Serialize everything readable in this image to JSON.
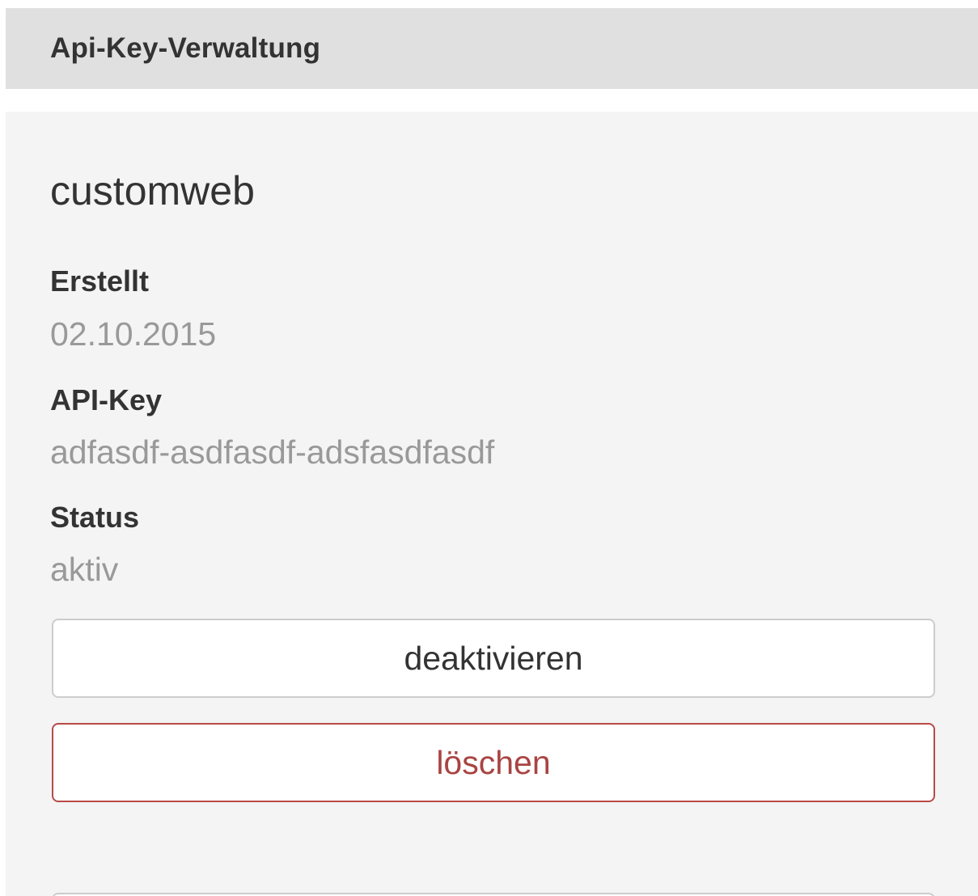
{
  "header": {
    "title": "Api-Key-Verwaltung"
  },
  "api_key_card": {
    "name": "customweb",
    "fields": {
      "created": {
        "label": "Erstellt",
        "value": "02.10.2015"
      },
      "api_key": {
        "label": "API-Key",
        "value": "adfasdf-asdfasdf-adsfasdfasdf"
      },
      "status": {
        "label": "Status",
        "value": "aktiv"
      }
    },
    "buttons": {
      "deactivate_label": "deaktivieren",
      "delete_label": "löschen"
    }
  },
  "colors": {
    "header_bg": "#e0e0e0",
    "card_bg": "#f4f4f4",
    "label_text": "#333333",
    "value_text": "#999999",
    "danger": "#a94442"
  }
}
